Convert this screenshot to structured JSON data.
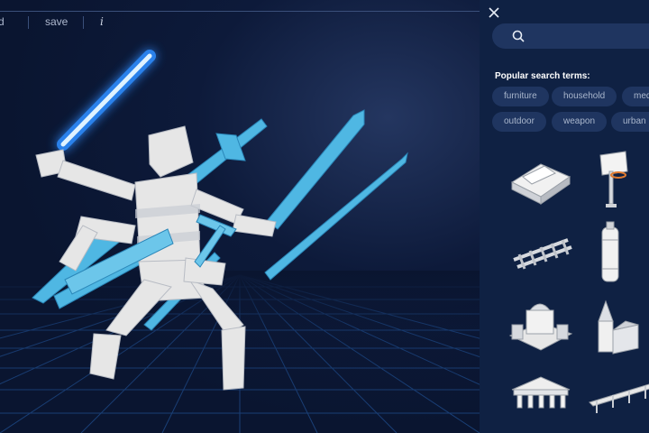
{
  "toolbar": {
    "first_label": "d",
    "save_label": "save",
    "info_label": "i"
  },
  "search": {
    "placeholder": "",
    "value": ""
  },
  "popular": {
    "title": "Popular search terms:",
    "terms": [
      "furniture",
      "household",
      "medieval",
      "outdoor",
      "weapon",
      "urban"
    ]
  },
  "results": [
    {
      "icon": "house-model-icon"
    },
    {
      "icon": "basketball-hoop-model-icon"
    },
    {
      "icon": "rail-track-model-icon"
    },
    {
      "icon": "gas-cylinder-model-icon"
    },
    {
      "icon": "castle-model-icon"
    },
    {
      "icon": "church-model-icon"
    },
    {
      "icon": "temple-model-icon"
    },
    {
      "icon": "bridge-model-icon"
    }
  ],
  "colors": {
    "panel_bg": "#0f2143",
    "chip_bg": "#1f3560",
    "viewport_bg": "#0a1530",
    "weapon_blue": "#4fb7e3",
    "saber_glow": "#2f8dff"
  }
}
